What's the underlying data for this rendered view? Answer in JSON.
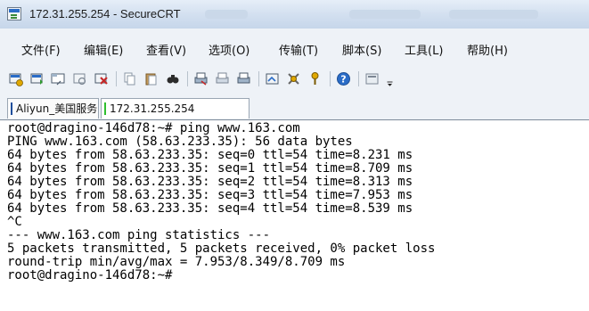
{
  "window": {
    "title": "172.31.255.254 - SecureCRT"
  },
  "menu": {
    "items": [
      "文件(F)",
      "编辑(E)",
      "查看(V)",
      "选项(O)",
      "传输(T)",
      "脚本(S)",
      "工具(L)",
      "帮助(H)"
    ]
  },
  "toolbar": {
    "buttons": [
      {
        "name": "connect-icon"
      },
      {
        "name": "quick-connect-icon"
      },
      {
        "name": "connect-in-tab-icon"
      },
      {
        "name": "reconnect-icon"
      },
      {
        "name": "disconnect-icon"
      },
      {
        "name": "copy-icon"
      },
      {
        "name": "paste-icon"
      },
      {
        "name": "find-icon"
      },
      {
        "name": "print-icon"
      },
      {
        "name": "print-selection-icon"
      },
      {
        "name": "printer-setup-icon"
      },
      {
        "name": "session-options-icon"
      },
      {
        "name": "global-options-icon"
      },
      {
        "name": "keymap-icon"
      },
      {
        "name": "help-icon"
      },
      {
        "name": "button-bar-icon"
      }
    ],
    "colors": {
      "accent_blue": "#2a6cc7",
      "accent_green": "#2f9a2f",
      "accent_red": "#c62828",
      "accent_yellow": "#e0a800"
    }
  },
  "tabs": [
    {
      "label": "Aliyun_美国服务器",
      "active": false,
      "bar_color": "#1f4e9b"
    },
    {
      "label": "172.31.255.254",
      "active": true,
      "bar_color": "#2fbf2f"
    }
  ],
  "terminal": {
    "lines": [
      "root@dragino-146d78:~# ping www.163.com",
      "PING www.163.com (58.63.233.35): 56 data bytes",
      "64 bytes from 58.63.233.35: seq=0 ttl=54 time=8.231 ms",
      "64 bytes from 58.63.233.35: seq=1 ttl=54 time=8.709 ms",
      "64 bytes from 58.63.233.35: seq=2 ttl=54 time=8.313 ms",
      "64 bytes from 58.63.233.35: seq=3 ttl=54 time=7.953 ms",
      "64 bytes from 58.63.233.35: seq=4 ttl=54 time=8.539 ms",
      "^C",
      "--- www.163.com ping statistics ---",
      "5 packets transmitted, 5 packets received, 0% packet loss",
      "round-trip min/avg/max = 7.953/8.349/8.709 ms",
      "root@dragino-146d78:~#"
    ]
  }
}
